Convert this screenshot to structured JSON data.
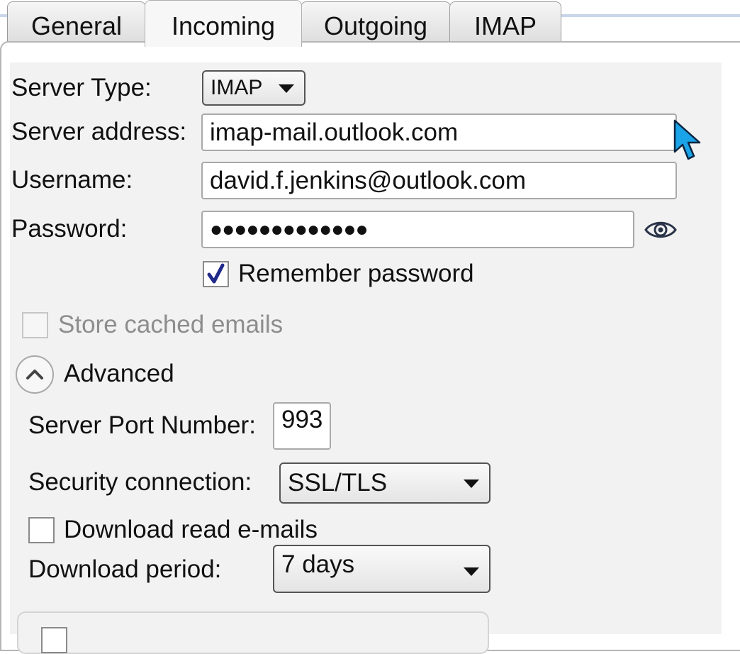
{
  "tabs": [
    {
      "label": "General"
    },
    {
      "label": "Incoming"
    },
    {
      "label": "Outgoing"
    },
    {
      "label": "IMAP"
    }
  ],
  "active_tab": "Incoming",
  "form": {
    "server_type_label": "Server Type:",
    "server_type_value": "IMAP",
    "server_address_label": "Server address:",
    "server_address_value": "imap-mail.outlook.com",
    "username_label": "Username:",
    "username_value": "david.f.jenkins@outlook.com",
    "password_label": "Password:",
    "password_masked": "●●●●●●●●●●●●●",
    "remember_password_label": "Remember password",
    "remember_password_checked": true,
    "store_cached_label": "Store cached emails",
    "store_cached_checked": false,
    "advanced_label": "Advanced"
  },
  "advanced": {
    "port_label": "Server Port Number:",
    "port_value": "993",
    "security_label": "Security connection:",
    "security_value": "SSL/TLS",
    "download_read_label": "Download read e-mails",
    "download_read_checked": false,
    "download_period_label": "Download period:",
    "download_period_value": "7 days"
  },
  "icons": {
    "password_toggle": "eye-icon",
    "advanced_toggle": "chevron-up-icon",
    "cursor": "mouse-pointer-icon"
  },
  "colors": {
    "cursor": "#1aa3e8",
    "check": "#1f2a8a"
  }
}
